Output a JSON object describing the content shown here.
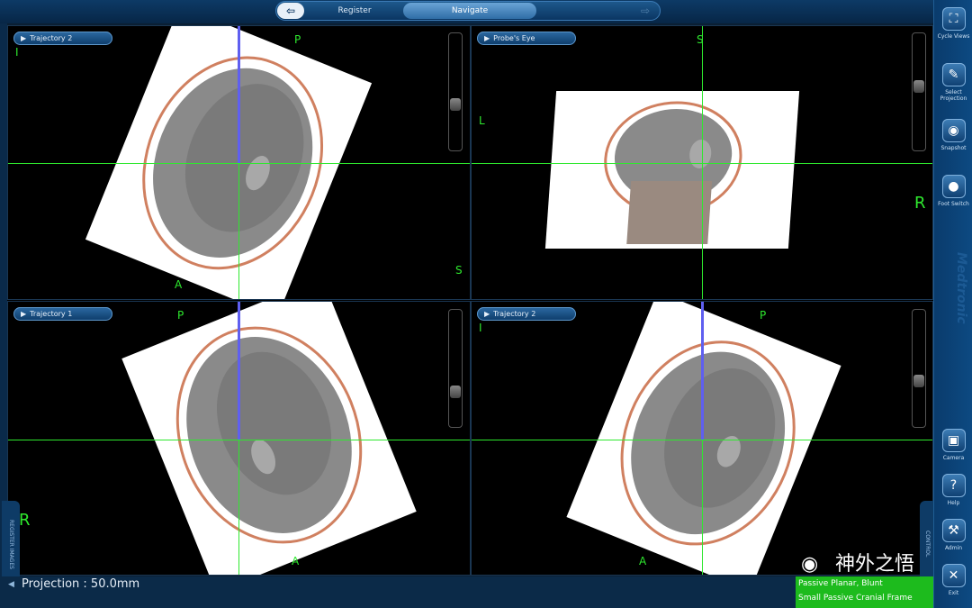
{
  "nav": {
    "back_icon": "arrow-left",
    "register_label": "Register",
    "navigate_label": "Navigate",
    "forward_icon": "arrow-right"
  },
  "views": {
    "top_left": {
      "label": "Trajectory 2",
      "orient": [
        "P",
        "A",
        "S",
        "I"
      ]
    },
    "top_right": {
      "label": "Probe's Eye",
      "orient": [
        "S",
        "L",
        "R"
      ]
    },
    "bottom_left": {
      "label": "Trajectory 1",
      "orient": [
        "P",
        "A",
        "R"
      ]
    },
    "bottom_right": {
      "label": "Trajectory 2",
      "orient": [
        "P",
        "A",
        "I"
      ]
    }
  },
  "tools": [
    {
      "label": "Cycle Views",
      "icon": "cycle-views-icon"
    },
    {
      "label": "Select Projection",
      "icon": "select-projection-icon"
    },
    {
      "label": "Snapshot",
      "icon": "camera-snapshot-icon"
    },
    {
      "label": "Foot Switch",
      "icon": "foot-switch-icon"
    },
    {
      "label": "Camera",
      "icon": "camera-icon"
    },
    {
      "label": "Help",
      "icon": "help-icon"
    },
    {
      "label": "Admin",
      "icon": "wrench-icon"
    },
    {
      "label": "Exit",
      "icon": "close-icon"
    }
  ],
  "brand": "Medtronic",
  "left_tab_label": "REGISTER IMAGES",
  "control_tab_label": "CONTROL",
  "status": {
    "projection": "Projection : 50.0mm",
    "instrument_line1": "Passive Planar, Blunt",
    "instrument_line2": "Small Passive Cranial Frame"
  },
  "watermark": "神外之悟",
  "colors": {
    "accent": "#2ee82e",
    "panel": "#0d4a82",
    "status_green": "#1dbb1d",
    "probe": "#5f5ff0"
  }
}
